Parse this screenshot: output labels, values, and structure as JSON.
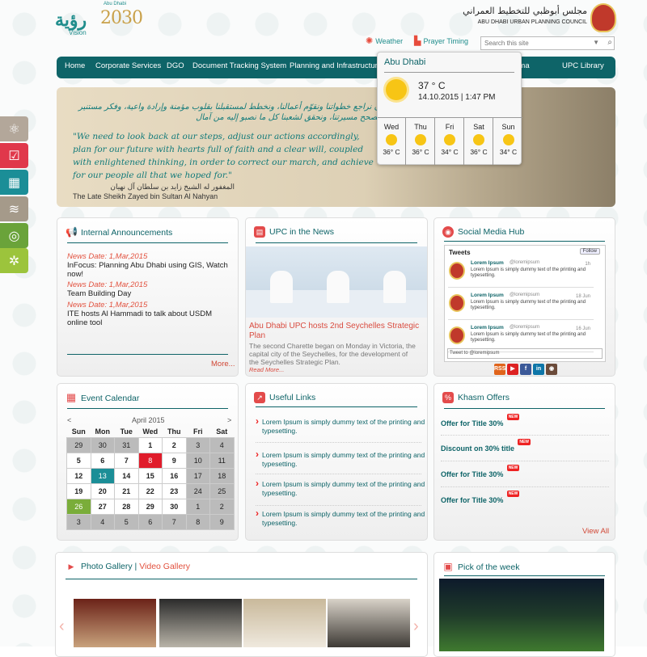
{
  "header": {
    "vision_ar": "رؤية",
    "vision_year": "2030",
    "vision_en": "Vision",
    "vision_ad": "Abu Dhabi",
    "council_ar": "مجلس أبوظبي للتخطيط العمراني",
    "council_en": "ABU DHABI URBAN PLANNING COUNCIL",
    "weather_label": "Weather",
    "prayer_label": "Prayer Timing",
    "search_placeholder": "Search this site"
  },
  "nav": [
    "Home",
    "Corporate Services",
    "DGO",
    "Document Tracking System",
    "Planning and Infrastructure",
    "Estidama",
    "UPC Library"
  ],
  "hero": {
    "arabic_quote": "إلى أن نراجع خطواتنا ونقوّم أعمالنا، ونخطط لمستقبلنا بقلوب مؤمنة وإرادة واعية، وفكر مستنير حتى نصحح مسيرتنا، ونحقق لشعبنا كل ما نصبو إليه من آمال",
    "english_quote": "\"We need to look back at our steps, adjust our actions accordingly, plan for our future with hearts full of faith and a clear will, coupled with enlightened thinking, in order to correct our march, and achieve for our people all that we hoped for.\"",
    "attribution_ar": "المغفور له الشيخ زايد بن سلطان آل نهيان",
    "attribution_en": "The Late Sheikh Zayed bin Sultan Al Nahyan"
  },
  "weather": {
    "city": "Abu Dhabi",
    "temp": "37 ° C",
    "datetime": "14.10.2015 | 1:47 PM",
    "forecast": [
      {
        "day": "Wed",
        "temp": "36° C"
      },
      {
        "day": "Thu",
        "temp": "36° C"
      },
      {
        "day": "Fri",
        "temp": "34° C"
      },
      {
        "day": "Sat",
        "temp": "36° C"
      },
      {
        "day": "Sun",
        "temp": "34° C"
      }
    ]
  },
  "announcements": {
    "title": "Internal Announcements",
    "items": [
      {
        "date": "News Date: 1,Mar,2015",
        "text": "InFocus: Planning Abu Dhabi using GIS, Watch now!"
      },
      {
        "date": "News Date: 1,Mar,2015",
        "text": "Team Building Day"
      },
      {
        "date": "News Date: 1,Mar,2015",
        "text": "ITE hosts Al Hammadi to talk about USDM online tool"
      }
    ],
    "more": "More..."
  },
  "news": {
    "title": "UPC in the News",
    "headline": "Abu Dhabi UPC hosts 2nd Seychelles Strategic Plan",
    "body": "The second Charette began on Monday in Victoria, the capital city of the Seychelles, for the development of the Seychelles Strategic Plan.",
    "read_more": "Read More..."
  },
  "social": {
    "title": "Social Media Hub",
    "tweets_label": "Tweets",
    "follow": "Follow",
    "tweets": [
      {
        "name": "Lorem Ipsum",
        "handle": "@loremipsum",
        "date": "1h",
        "text": "Lorem Ipsum is simply dummy text of the printing and typesetting."
      },
      {
        "name": "Lorem Ipsum",
        "handle": "@loremipsum",
        "date": "18 Jun",
        "text": "Lorem Ipsum is simply dummy text of the printing and typesetting."
      },
      {
        "name": "Lorem Ipsum",
        "handle": "@loremipsum",
        "date": "16 Jun",
        "text": "Lorem Ipsum is simply dummy text of the printing and typesetting."
      }
    ],
    "tweet_to": "Tweet to @loremipsum",
    "icons": [
      "RSS",
      "▶",
      "f",
      "in",
      "◉"
    ]
  },
  "calendar": {
    "title": "Event Calendar",
    "month": "April 2015",
    "prev": "<",
    "next": ">",
    "days": [
      "Sun",
      "Mon",
      "Tue",
      "Wed",
      "Thu",
      "Fri",
      "Sat"
    ],
    "weeks": [
      [
        "29",
        "30",
        "31",
        "1",
        "2",
        "3",
        "4"
      ],
      [
        "5",
        "6",
        "7",
        "8",
        "9",
        "10",
        "11"
      ],
      [
        "12",
        "13",
        "14",
        "15",
        "16",
        "17",
        "18"
      ],
      [
        "19",
        "20",
        "21",
        "22",
        "23",
        "24",
        "25"
      ],
      [
        "26",
        "27",
        "28",
        "29",
        "30",
        "1",
        "2"
      ],
      [
        "3",
        "4",
        "5",
        "6",
        "7",
        "8",
        "9"
      ]
    ],
    "today": "8",
    "highlight": "13",
    "green": "26"
  },
  "links": {
    "title": "Useful Links",
    "items": [
      "Lorem Ipsum is simply dummy text of the printing and typesetting.",
      "Lorem Ipsum is simply dummy text of the printing and typesetting.",
      "Lorem Ipsum is simply dummy text of the printing and typesetting.",
      "Lorem Ipsum is simply dummy text of the printing and typesetting."
    ]
  },
  "offers": {
    "title": "Khasm Offers",
    "items": [
      "Offer for Title 30%",
      "Discount on 30% title",
      "Offer for Title 30%",
      "Offer for Title 30%"
    ],
    "badge": "NEW",
    "view_all": "View All"
  },
  "gallery": {
    "photo": "Photo Gallery",
    "sep": "|",
    "video": "Video Gallery"
  },
  "pick": {
    "title": "Pick of the week"
  },
  "colors": {
    "teal": "#0e6468",
    "accent": "#e2513e",
    "calendar_red": "#e01c2b",
    "calendar_teal": "#1b8e97",
    "calendar_green": "#7aad3a"
  },
  "side_icons": [
    "atom-icon",
    "checklist-icon",
    "table-icon",
    "layers-icon",
    "fingerprint-icon",
    "network-icon"
  ]
}
